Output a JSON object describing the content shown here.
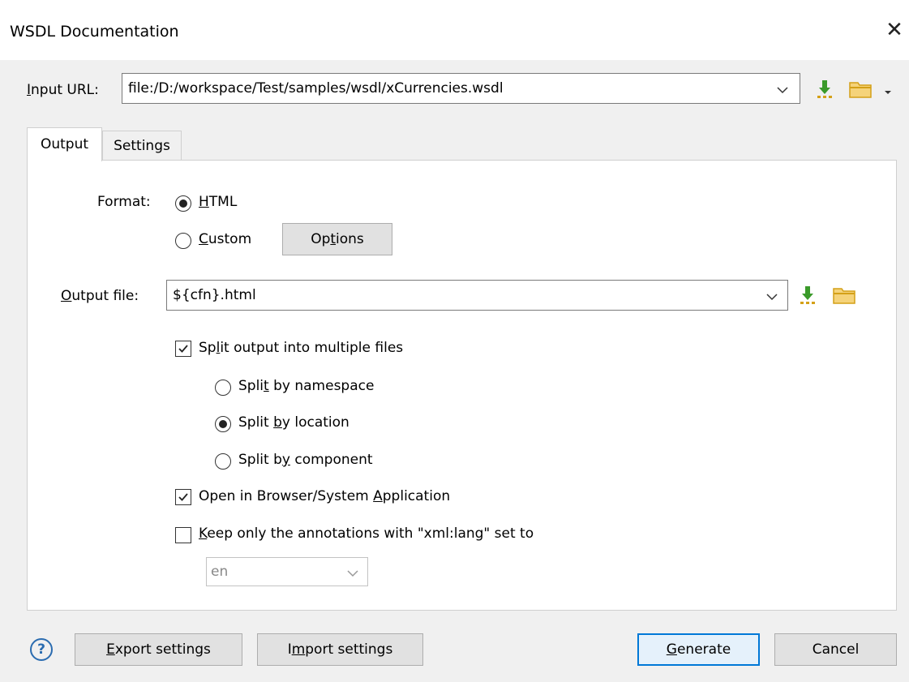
{
  "window": {
    "title": "WSDL Documentation",
    "close_icon": "close-icon"
  },
  "input_url": {
    "label_first": "I",
    "label_rest": "nput URL:",
    "value": "file:/D:/workspace/Test/samples/wsdl/xCurrencies.wsdl",
    "icons": [
      "insert-editor-variables-icon",
      "browse-folder-icon",
      "dropdown-arrow-icon"
    ]
  },
  "tabs": [
    {
      "label": "Output",
      "active": true
    },
    {
      "label": "Settings",
      "active": false
    }
  ],
  "format": {
    "label": "Format:",
    "html": {
      "pre": "",
      "mn": "H",
      "post": "TML",
      "selected": true
    },
    "custom": {
      "pre": "",
      "mn": "C",
      "post": "ustom",
      "selected": false
    },
    "options_button": {
      "pre": "Op",
      "mn": "t",
      "post": "ions"
    }
  },
  "output_file": {
    "label_first": "O",
    "label_rest": "utput file:",
    "value": "${cfn}.html"
  },
  "split": {
    "checkbox": {
      "pre": "Sp",
      "mn": "l",
      "post": "it output into multiple files",
      "checked": true
    },
    "by_namespace": {
      "pre": "Spli",
      "mn": "t",
      "post": " by namespace",
      "selected": false
    },
    "by_location": {
      "pre": "Split ",
      "mn": "b",
      "post": "y location",
      "selected": true
    },
    "by_component": {
      "pre": "Split b",
      "mn": "y",
      "post": " component",
      "selected": false
    }
  },
  "open_browser": {
    "pre": "Open in Browser/System ",
    "mn": "A",
    "post": "pplication",
    "checked": true
  },
  "keep_annotations": {
    "pre": "",
    "mn": "K",
    "post": "eep only the annotations with \"xml:lang\" set to",
    "checked": false
  },
  "lang_select": {
    "value": "en"
  },
  "footer": {
    "help": "?",
    "export": {
      "pre": "",
      "mn": "E",
      "post": "xport settings"
    },
    "import": {
      "pre": "I",
      "mn": "m",
      "post": "port settings"
    },
    "generate": {
      "pre": "",
      "mn": "G",
      "post": "enerate"
    },
    "cancel": "Cancel"
  },
  "colors": {
    "accent": "#0078d7",
    "icon_green": "#3a9a2a",
    "folder_yellow": "#e8b63a"
  }
}
